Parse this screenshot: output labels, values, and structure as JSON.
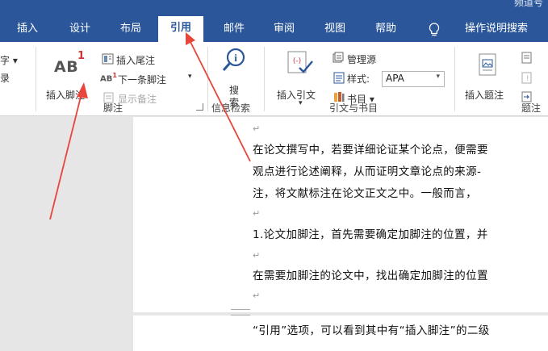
{
  "window": {
    "account_fragment": "频道号"
  },
  "tabs": [
    {
      "label": "插入",
      "active": false
    },
    {
      "label": "设计",
      "active": false
    },
    {
      "label": "布局",
      "active": false
    },
    {
      "label": "引用",
      "active": true
    },
    {
      "label": "邮件",
      "active": false
    },
    {
      "label": "审阅",
      "active": false
    },
    {
      "label": "视图",
      "active": false
    },
    {
      "label": "帮助",
      "active": false
    }
  ],
  "tell_me": {
    "label": "操作说明搜索",
    "icon": "lightbulb-icon"
  },
  "ribbon": {
    "toc": {
      "item1": "字 ▾",
      "item2": "录"
    },
    "footnotes": {
      "insert_footnote": "插入脚注",
      "insert_endnote": "插入尾注",
      "next_footnote": "下一条脚注",
      "next_footnote_arrow": "▾",
      "show_notes": "显示备注",
      "ab_text": "AB",
      "ab_sup": "1",
      "next_ab": "AB",
      "next_sup": "1",
      "group_label": "脚注"
    },
    "research": {
      "search_line1": "搜",
      "search_line2": "索",
      "group_label": "信息检索"
    },
    "citations": {
      "insert_citation": "插入引文",
      "insert_citation_arrow": "▾",
      "manage_sources": "管理源",
      "style_label": "样式:",
      "style_value": "APA",
      "style_arrow": "▾",
      "bibliography": "书目 ▾",
      "group_label": "引文与书目"
    },
    "captions": {
      "insert_caption": "插入题注",
      "group_label": "题注"
    }
  },
  "document": {
    "paragraph_mark": "↵",
    "lines": [
      "在论文撰写中，若要详细论证某个论点，便需要",
      "观点进行论述阐释，从而证明文章论点的来源-",
      "注，将文献标注在论文正文之中。一般而言，",
      "1.论文加脚注，首先需要确定加脚注的位置，并",
      "在需要加脚注的论文中，找出确定加脚注的位置",
      "“引用”选项，可以看到其中有“插入脚注”的二级"
    ]
  },
  "colors": {
    "ribbon_blue": "#2b579a",
    "annotation_red": "#e8453c"
  }
}
